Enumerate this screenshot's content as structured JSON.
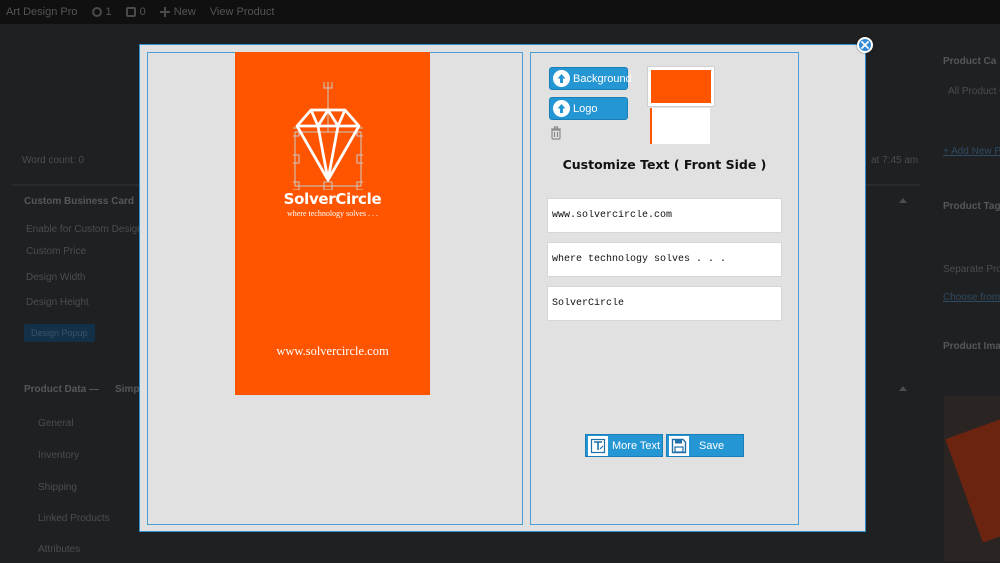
{
  "admin_bar": {
    "site_name": "Art Design Pro",
    "updates_count": "1",
    "comments_count": "0",
    "new_label": "New",
    "view_label": "View Product"
  },
  "background_page": {
    "word_count": "Word count: 0",
    "last_edited": "at 7:45 am",
    "custom_card_box": {
      "title": "Custom Business Card",
      "enable_label": "Enable for Custom Design",
      "price_label": "Custom Price",
      "width_label": "Design Width",
      "height_label": "Design Height",
      "button_label": "Design Popup"
    },
    "product_data": {
      "title": "Product Data —",
      "type": "Simp",
      "tabs": [
        "General",
        "Inventory",
        "Shipping",
        "Linked Products",
        "Attributes"
      ]
    },
    "right_sidebar": {
      "categories_title": "Product Ca",
      "all_categories": "All Product C",
      "add_new": "+ Add New P",
      "tags_title": "Product Tag",
      "tags_hint": "Separate Prod",
      "choose_link": "Choose from",
      "image_title": "Product Ima"
    }
  },
  "modal": {
    "card": {
      "name": "SolverCircle",
      "tagline": "where technology solves . . .",
      "url": "www.solvercircle.com",
      "background_color": "#ff5500",
      "text_color": "#ffffff",
      "logo_icon": "diamond-icon"
    },
    "buttons": {
      "background": "Background",
      "logo": "Logo",
      "more_text": "More Text",
      "save": "Save"
    },
    "customize_title": "Customize Text ( Front Side )",
    "text_fields": [
      "www.solvercircle.com",
      "where technology solves . . .",
      "SolverCircle"
    ],
    "colors": {
      "accent": "#2596d4",
      "border": "#4a9fd8",
      "panel_bg": "#e1e1e1"
    }
  }
}
